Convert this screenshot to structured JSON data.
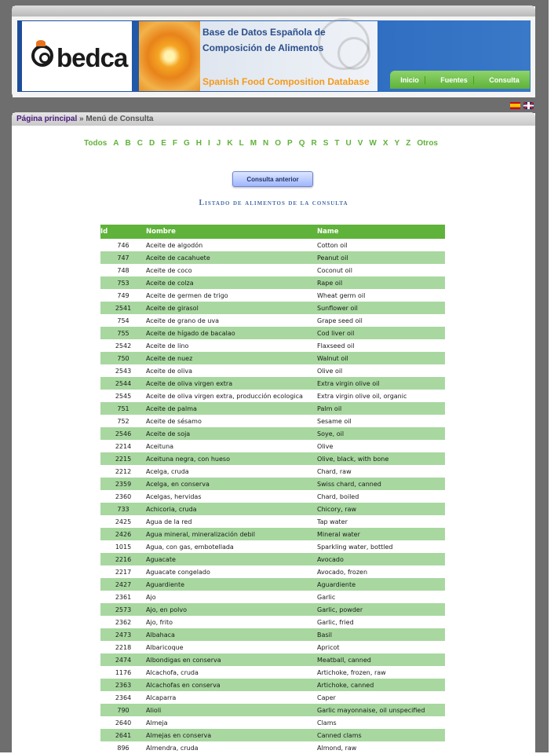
{
  "header": {
    "logo_text": "bedca",
    "title_line1": "Base de Datos Española de",
    "title_line2": "Composición de Alimentos",
    "subtitle": "Spanish Food Composition Database",
    "nav": [
      "Inicio",
      "Fuentes",
      "Consulta"
    ]
  },
  "breadcrumb": {
    "home": "Página principal",
    "separator": "»",
    "current": "Menú de Consulta"
  },
  "alphabet": [
    "Todos",
    "A",
    "B",
    "C",
    "D",
    "E",
    "F",
    "G",
    "H",
    "I",
    "J",
    "K",
    "L",
    "M",
    "N",
    "O",
    "P",
    "Q",
    "R",
    "S",
    "T",
    "U",
    "V",
    "W",
    "X",
    "Y",
    "Z",
    "Otros"
  ],
  "prev_button": "Consulta anterior",
  "list_title": "Listado de alimentos de la consulta",
  "table": {
    "headers": [
      "Id",
      "Nombre",
      "Name"
    ],
    "rows": [
      [
        "746",
        "Aceite de algodón",
        "Cotton oil"
      ],
      [
        "747",
        "Aceite de cacahuete",
        "Peanut oil"
      ],
      [
        "748",
        "Aceite de coco",
        "Coconut oil"
      ],
      [
        "753",
        "Aceite de colza",
        "Rape oil"
      ],
      [
        "749",
        "Aceite de germen de trigo",
        "Wheat germ oil"
      ],
      [
        "2541",
        "Aceite de girasol",
        "Sunflower oil"
      ],
      [
        "754",
        "Aceite de grano de uva",
        "Grape seed oil"
      ],
      [
        "755",
        "Aceite de hígado de bacalao",
        "Cod liver oil"
      ],
      [
        "2542",
        "Aceite de lino",
        "Flaxseed oil"
      ],
      [
        "750",
        "Aceite de nuez",
        "Walnut oil"
      ],
      [
        "2543",
        "Aceite de oliva",
        "Olive oil"
      ],
      [
        "2544",
        "Aceite de oliva virgen extra",
        "Extra virgin olive oil"
      ],
      [
        "2545",
        "Aceite de oliva virgen extra, producción ecologica",
        "Extra virgin olive oil, organic"
      ],
      [
        "751",
        "Aceite de palma",
        "Palm oil"
      ],
      [
        "752",
        "Aceite de sésamo",
        "Sesame oil"
      ],
      [
        "2546",
        "Aceite de soja",
        "Soye, oil"
      ],
      [
        "2214",
        "Aceituna",
        "Olive"
      ],
      [
        "2215",
        "Aceituna negra, con hueso",
        "Olive, black, with bone"
      ],
      [
        "2212",
        "Acelga, cruda",
        "Chard, raw"
      ],
      [
        "2359",
        "Acelga, en conserva",
        "Swiss chard, canned"
      ],
      [
        "2360",
        "Acelgas, hervidas",
        "Chard, boiled"
      ],
      [
        "733",
        "Achicoria, cruda",
        "Chicory, raw"
      ],
      [
        "2425",
        "Agua de la red",
        "Tap water"
      ],
      [
        "2426",
        "Agua mineral, mineralización debil",
        "Mineral water"
      ],
      [
        "1015",
        "Agua, con gas, embotellada",
        "Sparkling water, bottled"
      ],
      [
        "2216",
        "Aguacate",
        "Avocado"
      ],
      [
        "2217",
        "Aguacate congelado",
        "Avocado, frozen"
      ],
      [
        "2427",
        "Aguardiente",
        "Aguardiente"
      ],
      [
        "2361",
        "Ajo",
        "Garlic"
      ],
      [
        "2573",
        "Ajo, en polvo",
        "Garlic, powder"
      ],
      [
        "2362",
        "Ajo, frito",
        "Garlic, fried"
      ],
      [
        "2473",
        "Albahaca",
        "Basil"
      ],
      [
        "2218",
        "Albaricoque",
        "Apricot"
      ],
      [
        "2474",
        "Albondigas en conserva",
        "Meatball, canned"
      ],
      [
        "1176",
        "Alcachofa, cruda",
        "Artichoke, frozen, raw"
      ],
      [
        "2363",
        "Alcachofas en conserva",
        "Artichoke, canned"
      ],
      [
        "2364",
        "Alcaparra",
        "Caper"
      ],
      [
        "790",
        "Alioli",
        "Garlic mayonnaise, oil unspecified"
      ],
      [
        "2640",
        "Almeja",
        "Clams"
      ],
      [
        "2641",
        "Almejas en conserva",
        "Canned clams"
      ],
      [
        "896",
        "Almendra, cruda",
        "Almond, raw"
      ]
    ]
  },
  "colors": {
    "accent_green": "#5fb23a",
    "row_alt": "#a8d8a0",
    "banner_blue": "#2c6bbf",
    "title_blue": "#4a6fa5"
  },
  "icons": {
    "flag_es": "spanish-flag-icon",
    "flag_uk": "uk-flag-icon"
  }
}
